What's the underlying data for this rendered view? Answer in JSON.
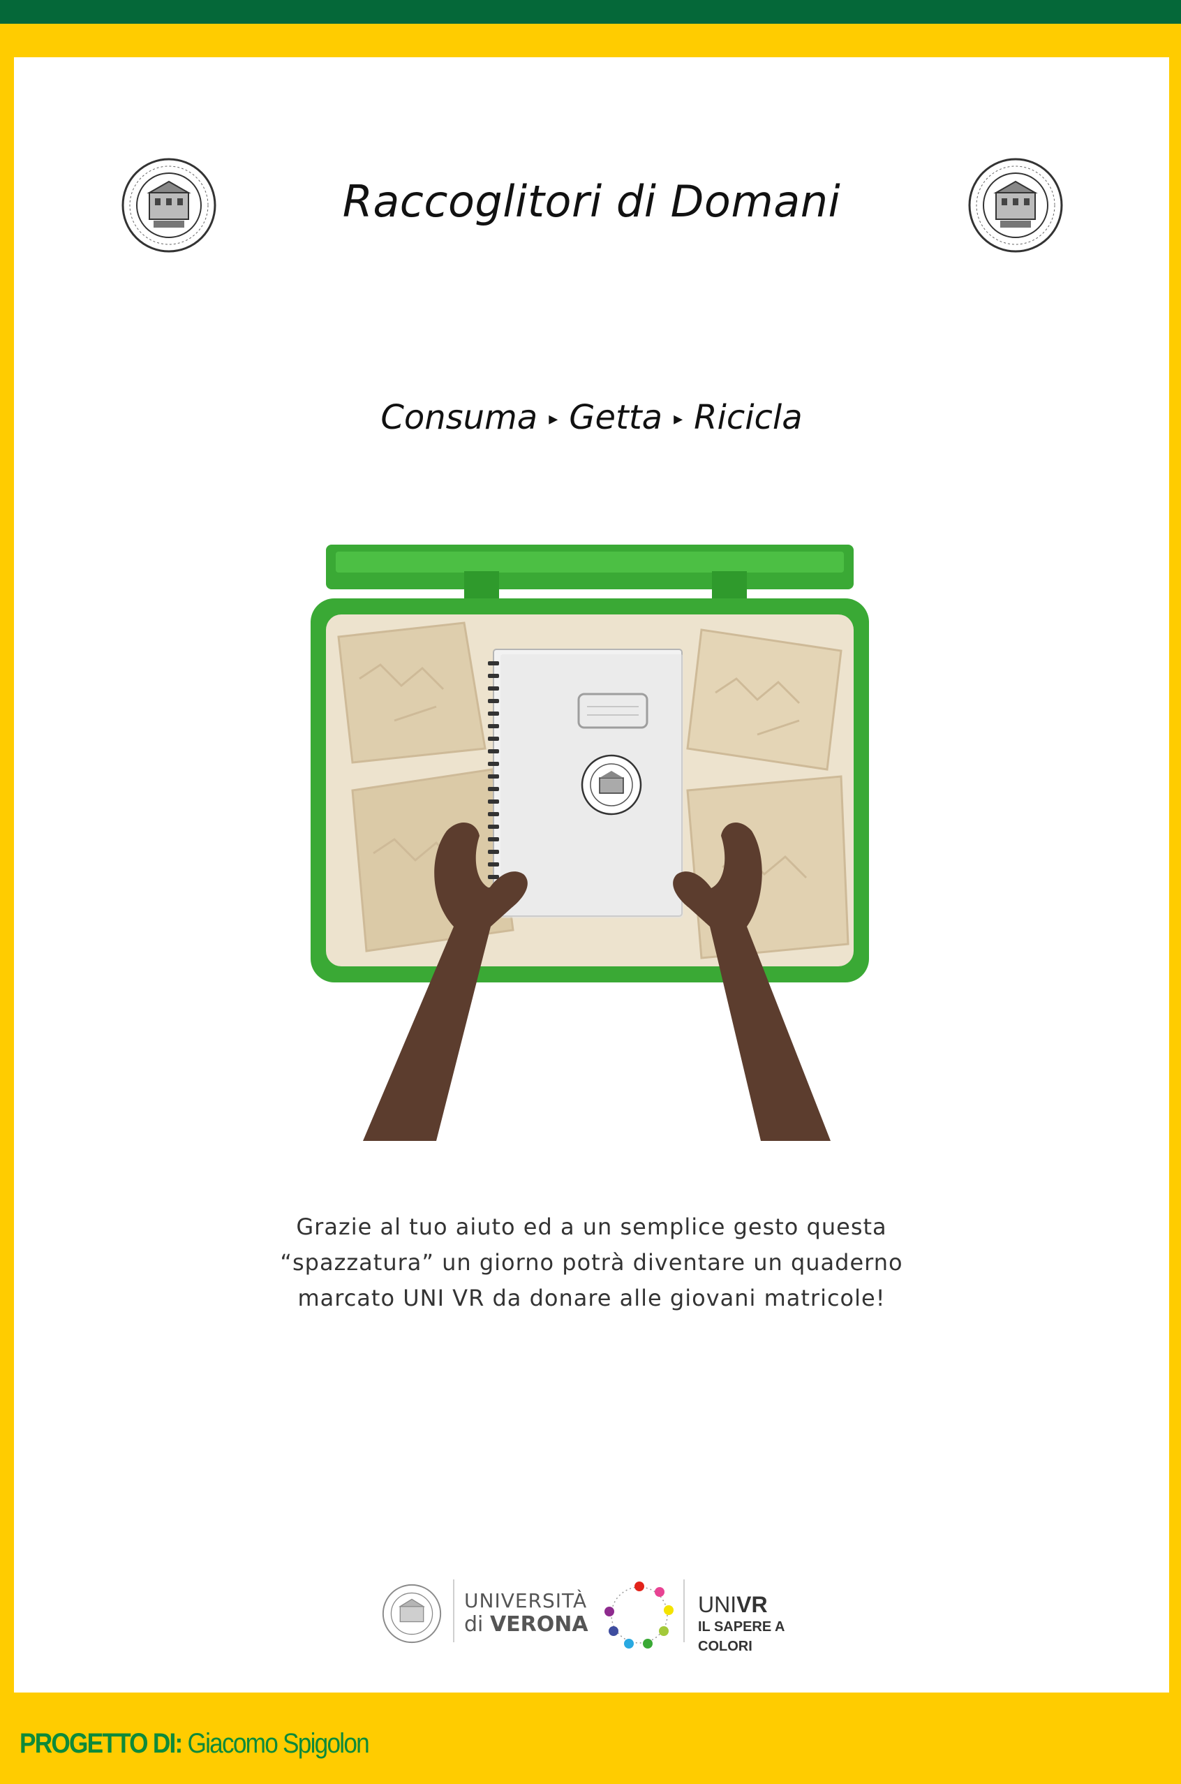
{
  "header": {
    "title": "Raccoglitori di Domani"
  },
  "slogan": {
    "steps": [
      "Consuma",
      "Getta",
      "Ricicla"
    ],
    "separator": "▸"
  },
  "message": {
    "lines": [
      "Grazie al tuo aiuto ed a un semplice gesto questa",
      "“spazzatura” un giorno potrà diventare un quaderno",
      "marcato UNI VR da donare alle giovani matricole!"
    ]
  },
  "logos": {
    "university_line1": "UNIVERSITÀ",
    "university_line2_prefix": "di",
    "university_line2_bold": "VERONA",
    "brand_light": "UNI",
    "brand_bold": "VR",
    "tagline": "IL SAPERE A COLORI"
  },
  "footer": {
    "credit_label": "PROGETTO DI:",
    "credit_name": "Giacomo Spigolon"
  },
  "colors": {
    "top_bar": "#056839",
    "frame": "#FFCC00",
    "bin_green": "#3AA935",
    "hand_brown": "#5C3D2E",
    "credit_green": "#0d8a3a"
  },
  "icons": {
    "seal": "university-seal-icon",
    "illustration": "recycle-bin-notebook-illustration"
  }
}
